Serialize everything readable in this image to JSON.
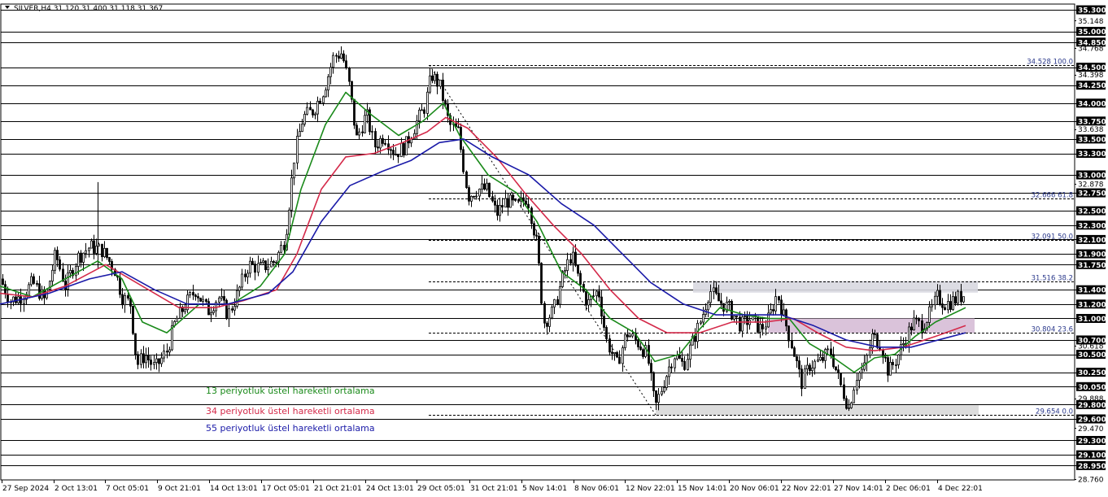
{
  "window": {
    "symbol_line": "SILVER,H4  31.120 31.400 31.118 31.367"
  },
  "colors": {
    "background": "#ffffff",
    "grid": "#000000",
    "axis_label_bg": "#000000",
    "candle": "#000000",
    "fib_line": "#000000",
    "fib_text": "#2c3a8c",
    "resistance_zone": "#d8d8e0",
    "support_zone": "#d8d8d8",
    "mid_zone": "#d6bcd6"
  },
  "chart_data": {
    "type": "candlestick",
    "instrument": "SILVER",
    "timeframe": "H4",
    "ohlc_header": {
      "open": 31.12,
      "high": 31.4,
      "low": 31.118,
      "close": 31.367
    },
    "y_range": [
      28.75,
      35.38
    ],
    "price_ticks": [
      "35.300",
      "35.148",
      "35.000",
      "34.850",
      "34.768",
      "34.500",
      "34.398",
      "34.250",
      "34.000",
      "33.750",
      "33.638",
      "33.500",
      "33.300",
      "33.000",
      "32.878",
      "32.750",
      "32.500",
      "32.300",
      "32.100",
      "31.900",
      "31.750",
      "31.400",
      "31.200",
      "31.000",
      "30.700",
      "30.618",
      "30.500",
      "30.250",
      "30.050",
      "29.888",
      "29.800",
      "29.600",
      "29.470",
      "29.300",
      "29.100",
      "28.950",
      "28.760"
    ],
    "highlighted_price_ticks": [
      "35.300",
      "35.000",
      "34.850",
      "34.500",
      "34.250",
      "34.000",
      "33.750",
      "33.500",
      "33.300",
      "33.000",
      "32.750",
      "32.500",
      "32.300",
      "32.100",
      "31.900",
      "31.750",
      "31.400",
      "31.200",
      "31.000",
      "30.700",
      "30.500",
      "30.250",
      "30.050",
      "29.800",
      "29.600",
      "29.300",
      "29.100",
      "28.950"
    ],
    "time_labels": [
      "27 Sep 2024",
      "2 Oct 13:01",
      "7 Oct 05:01",
      "9 Oct 21:01",
      "14 Oct 13:01",
      "17 Oct 05:01",
      "21 Oct 21:01",
      "24 Oct 13:01",
      "29 Oct 05:01",
      "31 Oct 21:01",
      "5 Nov 14:01",
      "8 Nov 06:01",
      "12 Nov 22:01",
      "15 Nov 14:01",
      "20 Nov 06:01",
      "22 Nov 22:01",
      "27 Nov 14:01",
      "2 Dec 06:01",
      "4 Dec 22:01"
    ],
    "fibonacci": {
      "levels": [
        {
          "price": 34.528,
          "label": "34.528 100.0"
        },
        {
          "price": 32.666,
          "label": "32.666 61.8"
        },
        {
          "price": 32.091,
          "label": "32.091 50.0"
        },
        {
          "price": 31.516,
          "label": "31.516 38.2"
        },
        {
          "price": 30.804,
          "label": "30.804 23.6"
        },
        {
          "price": 29.654,
          "label": "29.654 0.0"
        }
      ]
    },
    "zones": [
      {
        "name": "resistance",
        "low": 31.36,
        "high": 31.52
      },
      {
        "name": "mid",
        "low": 30.8,
        "high": 31.0
      },
      {
        "name": "support",
        "low": 29.65,
        "high": 29.79
      }
    ],
    "moving_averages": [
      {
        "name": "13 periyotluk üstel hareketli ortalama",
        "period": 13,
        "color": "#1a8a1a"
      },
      {
        "name": "34 periyotluk üstel hareketli ortalama",
        "period": 34,
        "color": "#d42a4a"
      },
      {
        "name": "55 periyotluk üstel hareketli ortalama",
        "period": 55,
        "color": "#1a1aa8"
      }
    ],
    "price_path": [
      [
        0,
        31.55
      ],
      [
        12,
        31.25
      ],
      [
        25,
        31.3
      ],
      [
        40,
        31.5
      ],
      [
        55,
        31.25
      ],
      [
        68,
        31.9
      ],
      [
        80,
        31.45
      ],
      [
        95,
        31.85
      ],
      [
        110,
        32.0
      ],
      [
        125,
        31.95
      ],
      [
        140,
        31.7
      ],
      [
        150,
        31.3
      ],
      [
        160,
        31.2
      ],
      [
        168,
        30.35
      ],
      [
        178,
        30.5
      ],
      [
        190,
        30.3
      ],
      [
        205,
        30.55
      ],
      [
        215,
        30.95
      ],
      [
        228,
        31.2
      ],
      [
        240,
        31.4
      ],
      [
        255,
        31.1
      ],
      [
        268,
        31.3
      ],
      [
        280,
        31.05
      ],
      [
        292,
        31.35
      ],
      [
        305,
        31.75
      ],
      [
        320,
        31.7
      ],
      [
        338,
        31.8
      ],
      [
        350,
        32.1
      ],
      [
        362,
        33.3
      ],
      [
        372,
        33.8
      ],
      [
        385,
        33.9
      ],
      [
        398,
        34.2
      ],
      [
        410,
        34.65
      ],
      [
        420,
        34.7
      ],
      [
        428,
        34.3
      ],
      [
        438,
        33.5
      ],
      [
        450,
        33.85
      ],
      [
        460,
        33.4
      ],
      [
        472,
        33.55
      ],
      [
        485,
        33.3
      ],
      [
        498,
        33.4
      ],
      [
        510,
        33.7
      ],
      [
        522,
        33.95
      ],
      [
        530,
        34.4
      ],
      [
        540,
        34.25
      ],
      [
        552,
        33.7
      ],
      [
        563,
        33.6
      ],
      [
        575,
        32.7
      ],
      [
        586,
        32.8
      ],
      [
        598,
        32.8
      ],
      [
        610,
        32.45
      ],
      [
        622,
        32.65
      ],
      [
        635,
        32.55
      ],
      [
        648,
        32.7
      ],
      [
        660,
        32.0
      ],
      [
        668,
        30.95
      ],
      [
        680,
        31.1
      ],
      [
        692,
        31.6
      ],
      [
        702,
        31.9
      ],
      [
        712,
        31.5
      ],
      [
        722,
        31.2
      ],
      [
        735,
        31.4
      ],
      [
        745,
        30.7
      ],
      [
        758,
        30.35
      ],
      [
        770,
        30.8
      ],
      [
        785,
        30.65
      ],
      [
        795,
        30.5
      ],
      [
        805,
        29.75
      ],
      [
        815,
        30.1
      ],
      [
        828,
        30.5
      ],
      [
        840,
        30.35
      ],
      [
        852,
        30.7
      ],
      [
        862,
        31.0
      ],
      [
        872,
        31.4
      ],
      [
        882,
        31.25
      ],
      [
        895,
        31.15
      ],
      [
        910,
        30.9
      ],
      [
        922,
        31.0
      ],
      [
        935,
        30.85
      ],
      [
        945,
        31.0
      ],
      [
        955,
        31.35
      ],
      [
        965,
        30.95
      ],
      [
        975,
        30.55
      ],
      [
        985,
        30.1
      ],
      [
        995,
        30.35
      ],
      [
        1008,
        30.4
      ],
      [
        1020,
        30.55
      ],
      [
        1032,
        30.1
      ],
      [
        1043,
        29.75
      ],
      [
        1052,
        30.2
      ],
      [
        1062,
        30.3
      ],
      [
        1072,
        30.75
      ],
      [
        1082,
        30.65
      ],
      [
        1092,
        30.25
      ],
      [
        1102,
        30.45
      ],
      [
        1112,
        30.7
      ],
      [
        1122,
        30.95
      ],
      [
        1132,
        30.9
      ],
      [
        1142,
        31.05
      ],
      [
        1152,
        31.3
      ],
      [
        1162,
        31.2
      ],
      [
        1172,
        31.25
      ],
      [
        1187,
        31.35
      ]
    ],
    "ema13_path": [
      [
        0,
        31.45
      ],
      [
        40,
        31.3
      ],
      [
        80,
        31.55
      ],
      [
        120,
        31.8
      ],
      [
        150,
        31.55
      ],
      [
        175,
        30.95
      ],
      [
        205,
        30.8
      ],
      [
        245,
        31.2
      ],
      [
        285,
        31.2
      ],
      [
        320,
        31.45
      ],
      [
        350,
        31.9
      ],
      [
        370,
        32.8
      ],
      [
        400,
        33.7
      ],
      [
        425,
        34.15
      ],
      [
        455,
        33.85
      ],
      [
        490,
        33.55
      ],
      [
        520,
        33.75
      ],
      [
        545,
        34.0
      ],
      [
        565,
        33.55
      ],
      [
        600,
        33.0
      ],
      [
        635,
        32.75
      ],
      [
        660,
        32.35
      ],
      [
        690,
        31.65
      ],
      [
        720,
        31.4
      ],
      [
        750,
        31.0
      ],
      [
        780,
        30.8
      ],
      [
        805,
        30.4
      ],
      [
        835,
        30.5
      ],
      [
        860,
        30.85
      ],
      [
        885,
        31.15
      ],
      [
        915,
        31.05
      ],
      [
        945,
        31.0
      ],
      [
        970,
        31.0
      ],
      [
        995,
        30.65
      ],
      [
        1025,
        30.45
      ],
      [
        1050,
        30.25
      ],
      [
        1075,
        30.45
      ],
      [
        1100,
        30.5
      ],
      [
        1125,
        30.75
      ],
      [
        1150,
        30.95
      ],
      [
        1187,
        31.15
      ]
    ],
    "ema34_path": [
      [
        0,
        31.35
      ],
      [
        40,
        31.3
      ],
      [
        80,
        31.45
      ],
      [
        130,
        31.75
      ],
      [
        175,
        31.45
      ],
      [
        220,
        31.15
      ],
      [
        265,
        31.15
      ],
      [
        300,
        31.25
      ],
      [
        340,
        31.4
      ],
      [
        365,
        31.9
      ],
      [
        395,
        32.8
      ],
      [
        425,
        33.25
      ],
      [
        460,
        33.3
      ],
      [
        495,
        33.45
      ],
      [
        525,
        33.6
      ],
      [
        548,
        33.8
      ],
      [
        575,
        33.65
      ],
      [
        610,
        33.25
      ],
      [
        645,
        32.75
      ],
      [
        680,
        32.3
      ],
      [
        715,
        31.9
      ],
      [
        750,
        31.4
      ],
      [
        785,
        31.0
      ],
      [
        820,
        30.8
      ],
      [
        860,
        30.8
      ],
      [
        900,
        30.95
      ],
      [
        940,
        30.95
      ],
      [
        975,
        31.0
      ],
      [
        1005,
        30.8
      ],
      [
        1040,
        30.6
      ],
      [
        1075,
        30.55
      ],
      [
        1110,
        30.6
      ],
      [
        1150,
        30.75
      ],
      [
        1187,
        30.9
      ]
    ],
    "ema55_path": [
      [
        0,
        31.2
      ],
      [
        60,
        31.35
      ],
      [
        110,
        31.55
      ],
      [
        150,
        31.65
      ],
      [
        190,
        31.4
      ],
      [
        230,
        31.2
      ],
      [
        280,
        31.2
      ],
      [
        330,
        31.35
      ],
      [
        360,
        31.65
      ],
      [
        395,
        32.35
      ],
      [
        430,
        32.85
      ],
      [
        470,
        33.05
      ],
      [
        505,
        33.2
      ],
      [
        540,
        33.45
      ],
      [
        570,
        33.5
      ],
      [
        605,
        33.25
      ],
      [
        650,
        33.0
      ],
      [
        690,
        32.6
      ],
      [
        730,
        32.3
      ],
      [
        765,
        31.9
      ],
      [
        800,
        31.5
      ],
      [
        840,
        31.2
      ],
      [
        880,
        31.05
      ],
      [
        920,
        31.05
      ],
      [
        960,
        31.05
      ],
      [
        1000,
        30.9
      ],
      [
        1040,
        30.7
      ],
      [
        1080,
        30.6
      ],
      [
        1120,
        30.6
      ],
      [
        1160,
        30.72
      ],
      [
        1187,
        30.8
      ]
    ]
  }
}
